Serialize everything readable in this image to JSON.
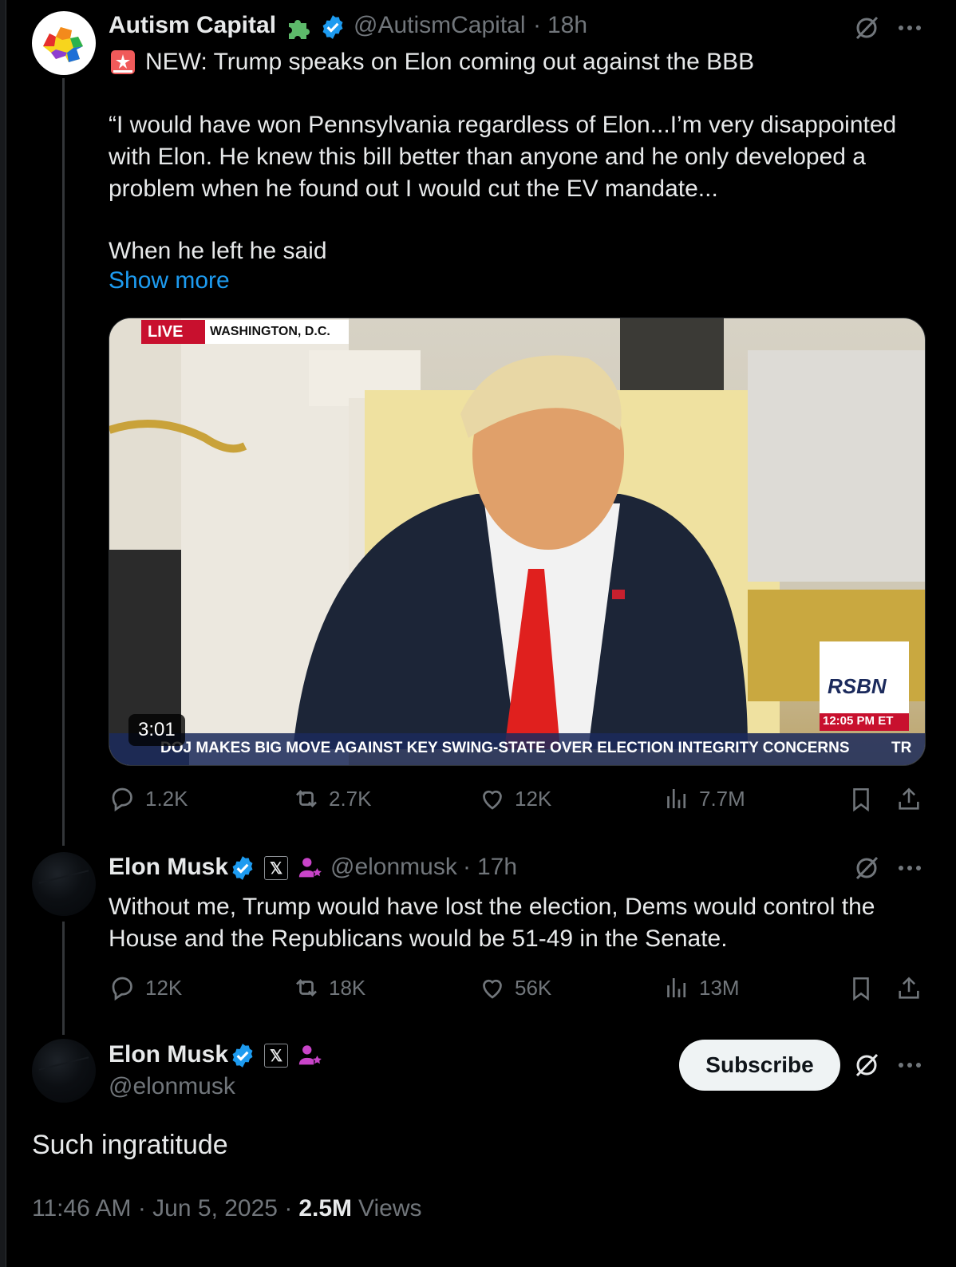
{
  "tweet1": {
    "display_name": "Autism Capital",
    "handle": "@AutismCapital",
    "time": "18h",
    "separator": "·",
    "headline": "NEW: Trump speaks on Elon coming out against the BBB",
    "paragraph1": "“I would have won Pennsylvania regardless of Elon...I’m very disappointed with Elon. He knew this bill better than anyone and he only developed a problem when he found out I would cut the EV mandate...",
    "paragraph2": "When he left he said",
    "show_more": "Show more",
    "video": {
      "live_label": "LIVE",
      "location": "WASHINGTON, D.C.",
      "duration": "3:01",
      "ticker": "DOJ MAKES BIG MOVE AGAINST KEY SWING-STATE OVER ELECTION INTEGRITY CONCERNS",
      "ticker_tail": "TR",
      "network": "RSBN",
      "clock": "12:05 PM ET"
    },
    "stats": {
      "replies": "1.2K",
      "reposts": "2.7K",
      "likes": "12K",
      "views": "7.7M"
    }
  },
  "tweet2": {
    "display_name": "Elon Musk",
    "handle": "@elonmusk",
    "time": "17h",
    "separator": "·",
    "badge_x": "𝕏",
    "text": "Without me, Trump would have lost the election, Dems would control the House and the Republicans would be 51-49 in the Senate.",
    "stats": {
      "replies": "12K",
      "reposts": "18K",
      "likes": "56K",
      "views": "13M"
    }
  },
  "tweet3": {
    "display_name": "Elon Musk",
    "handle": "@elonmusk",
    "badge_x": "𝕏",
    "subscribe_label": "Subscribe",
    "text": "Such ingratitude",
    "timestamp": "11:46 AM · Jun 5, 2025 ·",
    "views_count": "2.5M",
    "views_label": "Views"
  },
  "colors": {
    "background": "#000000",
    "text": "#e7e9ea",
    "secondary": "#71767b",
    "link": "#1d9bf0",
    "verified": "#1d9bf0",
    "affiliate_icon": "#c944c9"
  },
  "icons": [
    "grok-icon",
    "more-icon",
    "reply-icon",
    "repost-icon",
    "like-icon",
    "views-icon",
    "bookmark-icon",
    "share-icon",
    "verified-icon",
    "siren-icon",
    "puzzle-icon"
  ]
}
